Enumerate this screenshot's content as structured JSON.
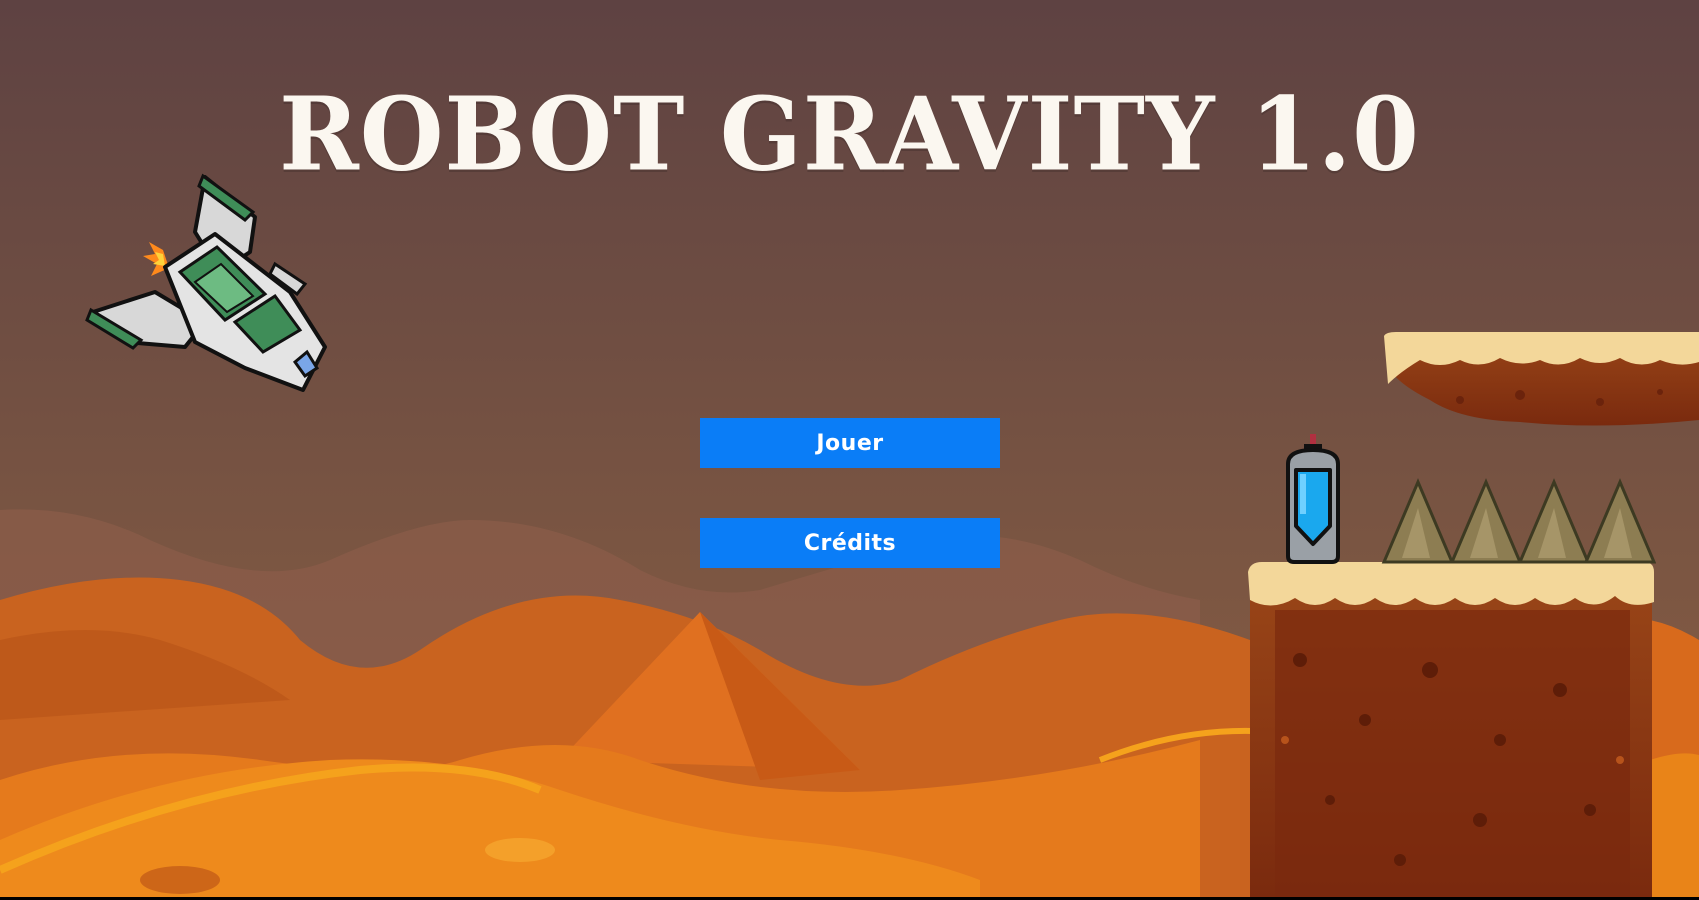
{
  "game": {
    "title": "ROBOT GRAVITY 1.0"
  },
  "menu": {
    "play_label": "Jouer",
    "credits_label": "Crédits"
  },
  "colors": {
    "sky_top": "#5e4242",
    "sky_bottom": "#7e5a45",
    "button": "#0a7df7",
    "title": "#fbf7f0",
    "dunes_back": "#d56f2a",
    "dunes_front": "#e8831b",
    "platform_top": "#f3d79a",
    "platform_dirt": "#8a3513"
  },
  "icons": {
    "ship": "spaceship-icon",
    "capsule": "checkpoint-capsule-icon",
    "spikes": "spike-icon"
  }
}
